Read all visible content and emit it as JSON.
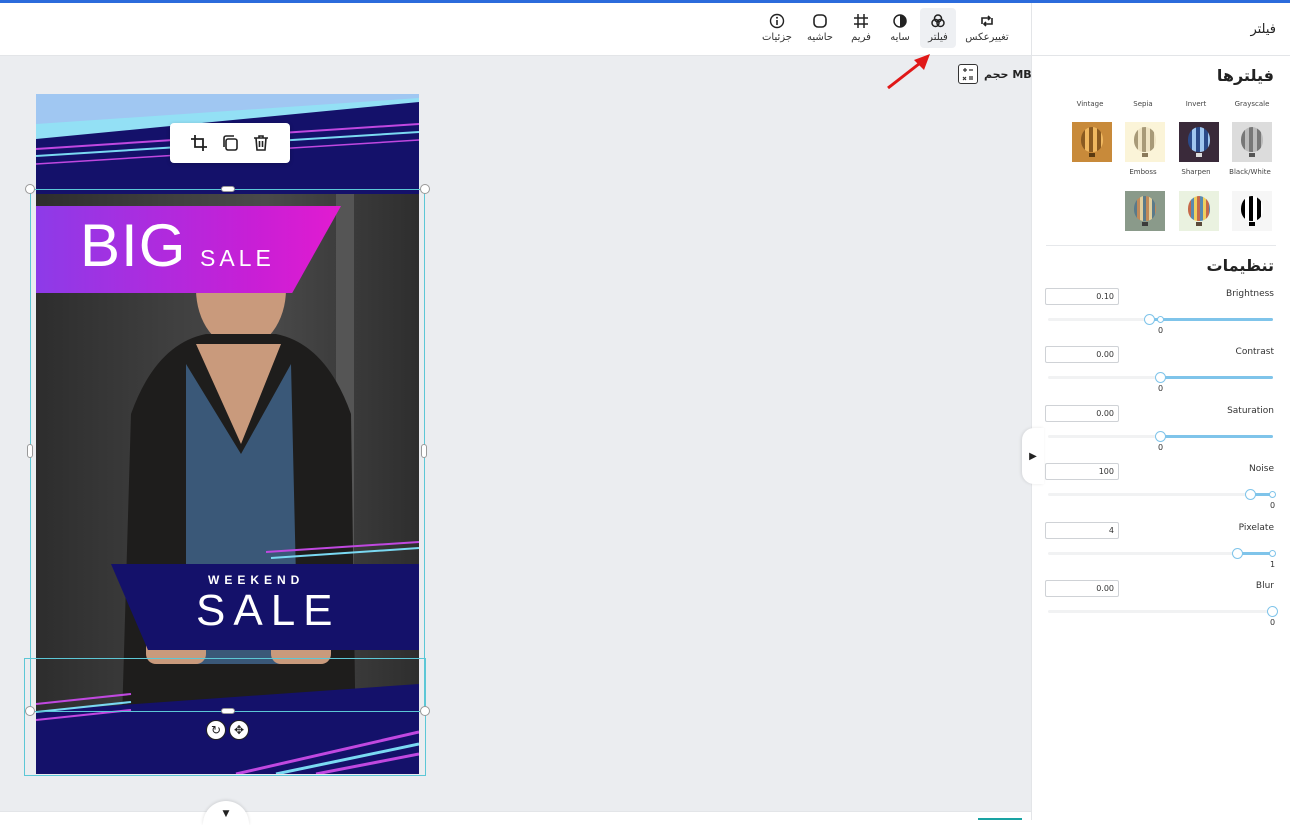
{
  "toolbar": {
    "tools": [
      {
        "label": "تغییرعکس",
        "icon": "swap-icon"
      },
      {
        "label": "فیلتر",
        "icon": "filter-icon",
        "active": true
      },
      {
        "label": "سایه",
        "icon": "shadow-icon"
      },
      {
        "label": "فریم",
        "icon": "frame-icon"
      },
      {
        "label": "حاشیه",
        "icon": "border-icon"
      },
      {
        "label": "جزئیات",
        "icon": "info-icon"
      }
    ]
  },
  "canvas": {
    "size_label": "حجم MB",
    "poster": {
      "big": "BIG",
      "sale_small": "SALE",
      "weekend": "WEEKEND",
      "sale_large": "SALE"
    }
  },
  "sidebar": {
    "title": "فیلتر",
    "filters_heading": "فیلترها",
    "filters": [
      {
        "name": "Grayscale",
        "color": "#9a9a9a"
      },
      {
        "name": "Invert",
        "color": "#3b5a9a"
      },
      {
        "name": "Sepia",
        "color": "#e8dcc0"
      },
      {
        "name": "Vintage",
        "color": "#d0903c"
      },
      {
        "name": "Black/White",
        "color": "#111111"
      },
      {
        "name": "Sharpen",
        "color": "#d17a5a"
      },
      {
        "name": "Emboss",
        "color": "#6f8a9a"
      }
    ],
    "settings_heading": "تنظیمات",
    "settings": [
      {
        "name": "Brightness",
        "value": "0.10",
        "min_label": "0"
      },
      {
        "name": "Contrast",
        "value": "0.00",
        "min_label": "0"
      },
      {
        "name": "Saturation",
        "value": "0.00",
        "min_label": "0"
      },
      {
        "name": "Noise",
        "value": "100",
        "min_label": "0"
      },
      {
        "name": "Pixelate",
        "value": "4",
        "min_label": "1"
      },
      {
        "name": "Blur",
        "value": "0.00",
        "min_label": "0"
      }
    ]
  }
}
